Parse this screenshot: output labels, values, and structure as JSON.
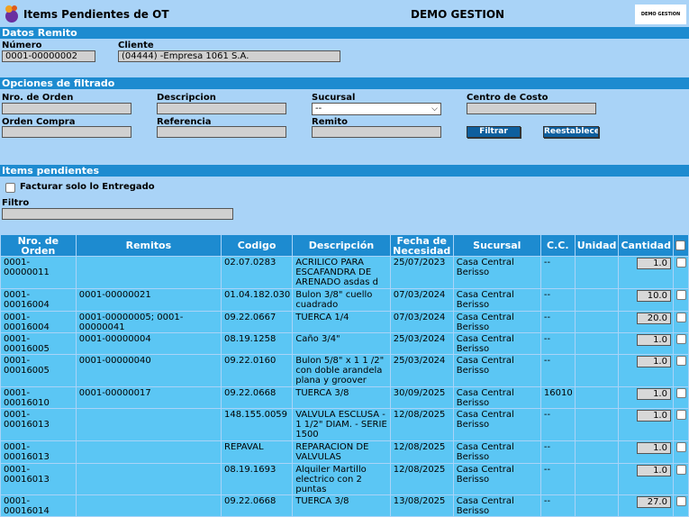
{
  "header": {
    "title": "Items Pendientes de OT",
    "center": "DEMO GESTION",
    "logo_text": "DEMO GESTION"
  },
  "datos_remito": {
    "section": "Datos Remito",
    "numero_label": "Número",
    "numero_value": "0001-00000002",
    "cliente_label": "Cliente",
    "cliente_value": "(04444) -Empresa 1061 S.A."
  },
  "filtros": {
    "section": "Opciones de filtrado",
    "nro_orden_label": "Nro. de Orden",
    "descripcion_label": "Descripcion",
    "sucursal_label": "Sucursal",
    "sucursal_value": "--",
    "centro_costo_label": "Centro de Costo",
    "orden_compra_label": "Orden Compra",
    "referencia_label": "Referencia",
    "remito_label": "Remito",
    "filtrar_button": "Filtrar",
    "reestablecer_button": "Reestablecer"
  },
  "items": {
    "section": "Items pendientes",
    "facturar_label": "Facturar solo lo Entregado",
    "filtro_label": "Filtro",
    "columns": [
      "Nro. de Orden",
      "Remitos",
      "Codigo",
      "Descripción",
      "Fecha de Necesidad",
      "Sucursal",
      "C.C.",
      "Unidad",
      "Cantidad"
    ],
    "rows": [
      {
        "orden": "0001-00000011",
        "remitos": "",
        "codigo": "02.07.0283",
        "descripcion": "ACRILICO PARA ESCAFANDRA DE ARENADO asdas d",
        "fecha": "25/07/2023",
        "sucursal": "Casa Central Berisso",
        "cc": "--",
        "unidad": "",
        "cantidad": "1.0"
      },
      {
        "orden": "0001-00016004",
        "remitos": "0001-00000021",
        "codigo": "01.04.182.030",
        "descripcion": "Bulon 3/8\" cuello cuadrado",
        "fecha": "07/03/2024",
        "sucursal": "Casa Central Berisso",
        "cc": "--",
        "unidad": "",
        "cantidad": "10.0"
      },
      {
        "orden": "0001-00016004",
        "remitos": "0001-00000005; 0001-00000041",
        "codigo": "09.22.0667",
        "descripcion": "TUERCA 1/4",
        "fecha": "07/03/2024",
        "sucursal": "Casa Central Berisso",
        "cc": "--",
        "unidad": "",
        "cantidad": "20.0"
      },
      {
        "orden": "0001-00016005",
        "remitos": "0001-00000004",
        "codigo": "08.19.1258",
        "descripcion": "Caño 3/4\"",
        "fecha": "25/03/2024",
        "sucursal": "Casa Central Berisso",
        "cc": "--",
        "unidad": "",
        "cantidad": "1.0"
      },
      {
        "orden": "0001-00016005",
        "remitos": "0001-00000040",
        "codigo": "09.22.0160",
        "descripcion": "Bulon 5/8\" x 1 1 /2\" con doble arandela plana y groover",
        "fecha": "25/03/2024",
        "sucursal": "Casa Central Berisso",
        "cc": "--",
        "unidad": "",
        "cantidad": "1.0"
      },
      {
        "orden": "0001-00016010",
        "remitos": "0001-00000017",
        "codigo": "09.22.0668",
        "descripcion": "TUERCA 3/8",
        "fecha": "30/09/2025",
        "sucursal": "Casa Central Berisso",
        "cc": "16010",
        "unidad": "",
        "cantidad": "1.0"
      },
      {
        "orden": "0001-00016013",
        "remitos": "",
        "codigo": "148.155.0059",
        "descripcion": "VALVULA ESCLUSA - 1 1/2\" DIAM. - SERIE 1500",
        "fecha": "12/08/2025",
        "sucursal": "Casa Central Berisso",
        "cc": "--",
        "unidad": "",
        "cantidad": "1.0"
      },
      {
        "orden": "0001-00016013",
        "remitos": "",
        "codigo": "REPAVAL",
        "descripcion": "REPARACION DE VALVULAS",
        "fecha": "12/08/2025",
        "sucursal": "Casa Central Berisso",
        "cc": "--",
        "unidad": "",
        "cantidad": "1.0"
      },
      {
        "orden": "0001-00016013",
        "remitos": "",
        "codigo": "08.19.1693",
        "descripcion": "Alquiler Martillo electrico con 2 puntas",
        "fecha": "12/08/2025",
        "sucursal": "Casa Central Berisso",
        "cc": "--",
        "unidad": "",
        "cantidad": "1.0"
      },
      {
        "orden": "0001-00016014",
        "remitos": "",
        "codigo": "09.22.0668",
        "descripcion": "TUERCA 3/8",
        "fecha": "13/08/2025",
        "sucursal": "Casa Central Berisso",
        "cc": "--",
        "unidad": "",
        "cantidad": "27.0"
      }
    ]
  }
}
